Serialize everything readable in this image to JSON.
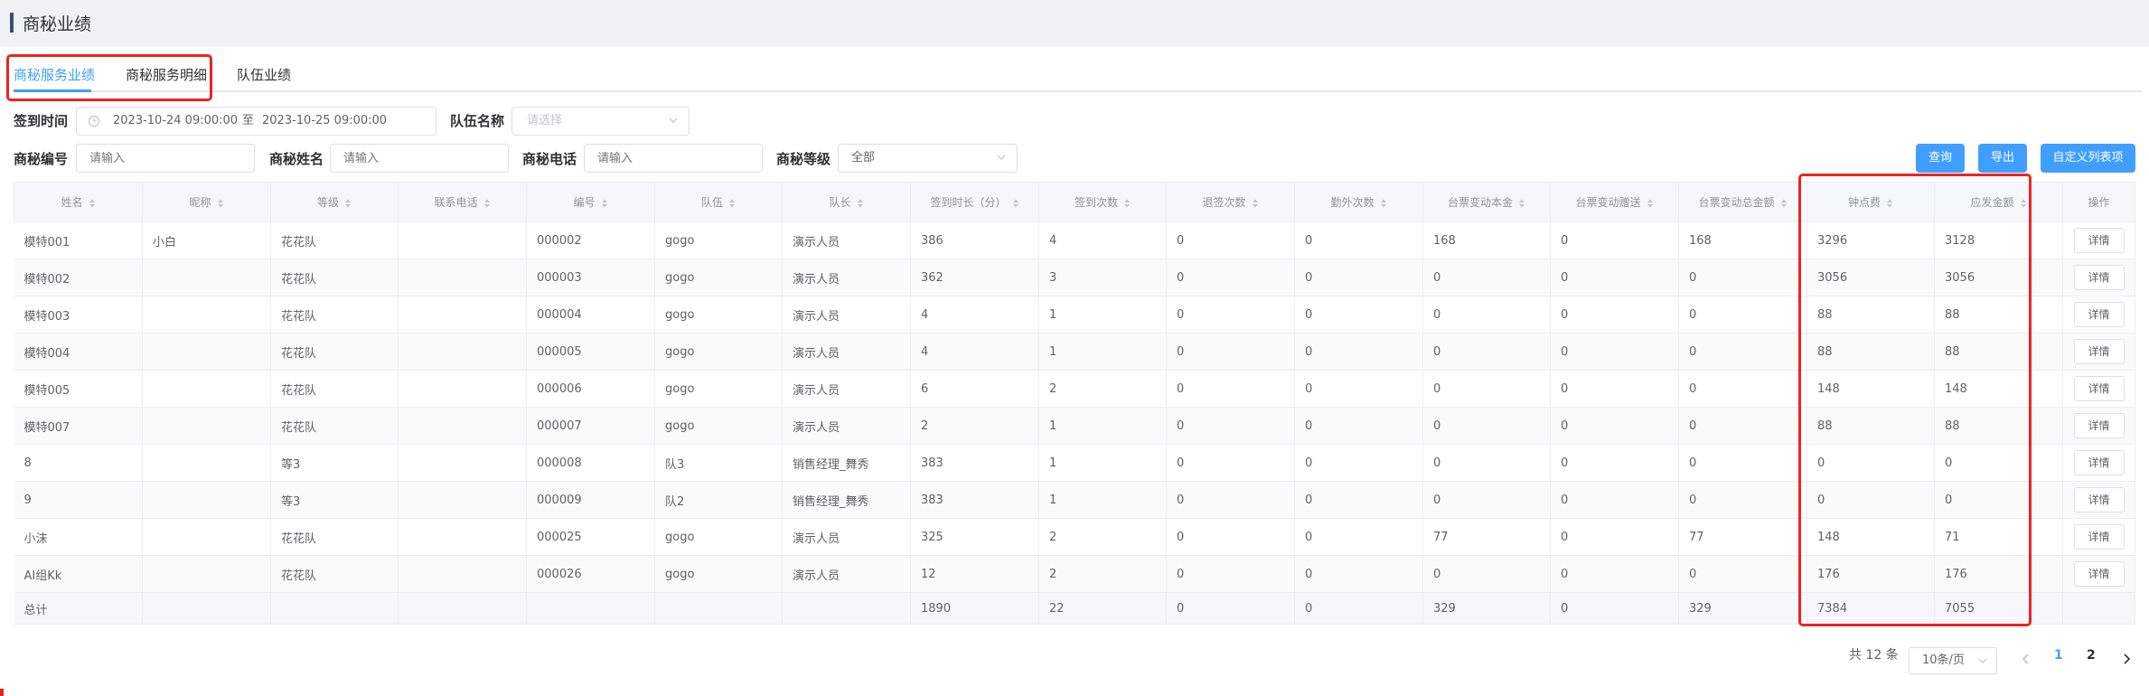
{
  "page": {
    "title": "商秘业绩"
  },
  "tabs": [
    "商秘服务业绩",
    "商秘服务明细",
    "队伍业绩"
  ],
  "filters": {
    "checkin_label": "签到时间",
    "date_start": "2023-10-24 09:00:00",
    "date_sep": "至",
    "date_end": "2023-10-25 09:00:00",
    "team_label": "队伍名称",
    "team_placeholder": "请选择",
    "code_label": "商秘编号",
    "code_placeholder": "请输入",
    "name_label": "商秘姓名",
    "name_placeholder": "请输入",
    "phone_label": "商秘电话",
    "phone_placeholder": "请输入",
    "level_label": "商秘等级",
    "level_value": "全部"
  },
  "buttons": {
    "query": "查询",
    "export": "导出",
    "custom_columns": "自定义列表项",
    "detail": "详情"
  },
  "table": {
    "headers": [
      "姓名",
      "昵称",
      "等级",
      "联系电话",
      "编号",
      "队伍",
      "队长",
      "签到时长（分）",
      "签到次数",
      "退签次数",
      "勤外次数",
      "台票变动本金",
      "台票变动赠送",
      "台票变动总金额",
      "钟点费",
      "应发金额",
      "操作"
    ],
    "rows": [
      [
        "模特001",
        "小白",
        "花花队",
        "",
        "000002",
        "gogo",
        "演示人员",
        "386",
        "4",
        "0",
        "0",
        "168",
        "0",
        "168",
        "3296",
        "3128"
      ],
      [
        "模特002",
        "",
        "花花队",
        "",
        "000003",
        "gogo",
        "演示人员",
        "362",
        "3",
        "0",
        "0",
        "0",
        "0",
        "0",
        "3056",
        "3056"
      ],
      [
        "模特003",
        "",
        "花花队",
        "",
        "000004",
        "gogo",
        "演示人员",
        "4",
        "1",
        "0",
        "0",
        "0",
        "0",
        "0",
        "88",
        "88"
      ],
      [
        "模特004",
        "",
        "花花队",
        "",
        "000005",
        "gogo",
        "演示人员",
        "4",
        "1",
        "0",
        "0",
        "0",
        "0",
        "0",
        "88",
        "88"
      ],
      [
        "模特005",
        "",
        "花花队",
        "",
        "000006",
        "gogo",
        "演示人员",
        "6",
        "2",
        "0",
        "0",
        "0",
        "0",
        "0",
        "148",
        "148"
      ],
      [
        "模特007",
        "",
        "花花队",
        "",
        "000007",
        "gogo",
        "演示人员",
        "2",
        "1",
        "0",
        "0",
        "0",
        "0",
        "0",
        "88",
        "88"
      ],
      [
        "8",
        "",
        "等3",
        "",
        "000008",
        "队3",
        "销售经理_舞秀",
        "383",
        "1",
        "0",
        "0",
        "0",
        "0",
        "0",
        "0",
        "0"
      ],
      [
        "9",
        "",
        "等3",
        "",
        "000009",
        "队2",
        "销售经理_舞秀",
        "383",
        "1",
        "0",
        "0",
        "0",
        "0",
        "0",
        "0",
        "0"
      ],
      [
        "小沫",
        "",
        "花花队",
        "",
        "000025",
        "gogo",
        "演示人员",
        "325",
        "2",
        "0",
        "0",
        "77",
        "0",
        "77",
        "148",
        "71"
      ],
      [
        "AI组Kk",
        "",
        "花花队",
        "",
        "000026",
        "gogo",
        "演示人员",
        "12",
        "2",
        "0",
        "0",
        "0",
        "0",
        "0",
        "176",
        "176"
      ]
    ],
    "total": [
      "总计",
      "",
      "",
      "",
      "",
      "",
      "",
      "1890",
      "22",
      "0",
      "0",
      "329",
      "0",
      "329",
      "7384",
      "7055",
      ""
    ]
  },
  "pagination": {
    "total_text": "共 12 条",
    "page_size": "10条/页",
    "pages": [
      "1",
      "2"
    ],
    "current": "1"
  },
  "colors": {
    "primary": "#409eff",
    "highlight": "#ee2222",
    "title_bar": "#3a4f7a"
  }
}
